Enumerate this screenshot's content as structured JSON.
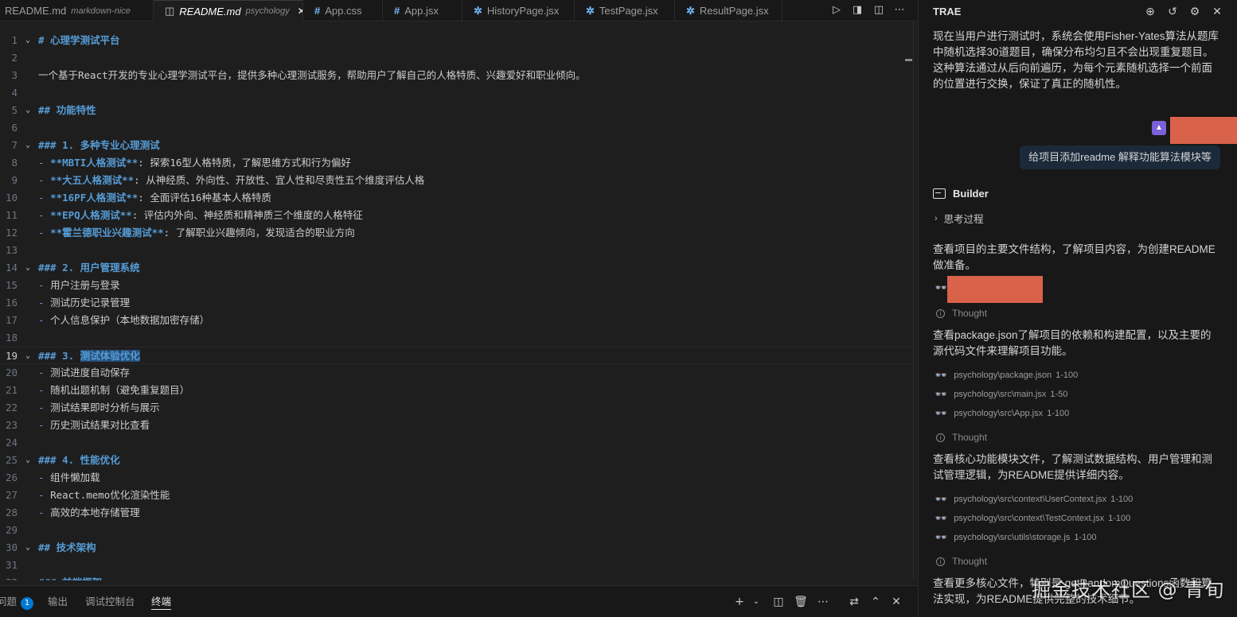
{
  "tabs": [
    {
      "title": "README.md",
      "desc": "markdown-nice",
      "icon": "markdown-icon",
      "active": false,
      "italic": false
    },
    {
      "title": "README.md",
      "desc": "psychology",
      "icon": "markdown-icon",
      "active": true,
      "italic": true,
      "close": "✕"
    },
    {
      "title": "App.css",
      "icon": "hash-icon"
    },
    {
      "title": "App.jsx",
      "icon": "hash-icon"
    },
    {
      "title": "HistoryPage.jsx",
      "icon": "gear-icon"
    },
    {
      "title": "TestPage.jsx",
      "icon": "gear-icon"
    },
    {
      "title": "ResultPage.jsx",
      "icon": "gear-icon"
    }
  ],
  "editor": {
    "current_line": 19,
    "lines": [
      {
        "n": "1",
        "fold": true,
        "parts": [
          {
            "t": "# 心理学测试平台",
            "c": "hd"
          }
        ]
      },
      {
        "n": "2",
        "parts": []
      },
      {
        "n": "3",
        "parts": [
          {
            "t": "一个基于React开发的专业心理学测试平台，提供多种心理测试服务，帮助用户了解自己的人格特质、兴趣爱好和职业倾向。",
            "c": ""
          }
        ]
      },
      {
        "n": "4",
        "parts": []
      },
      {
        "n": "5",
        "fold": true,
        "parts": [
          {
            "t": "## 功能特性",
            "c": "hd"
          }
        ]
      },
      {
        "n": "6",
        "parts": []
      },
      {
        "n": "7",
        "fold": true,
        "parts": [
          {
            "t": "### 1. 多种专业心理测试",
            "c": "hd"
          }
        ]
      },
      {
        "n": "8",
        "parts": [
          {
            "t": "- ",
            "c": "bullet"
          },
          {
            "t": "**MBTI人格测试**",
            "c": "bold"
          },
          {
            "t": ": 探索16型人格特质，了解思维方式和行为偏好",
            "c": ""
          }
        ]
      },
      {
        "n": "9",
        "parts": [
          {
            "t": "- ",
            "c": "bullet"
          },
          {
            "t": "**大五人格测试**",
            "c": "bold"
          },
          {
            "t": ": 从神经质、外向性、开放性、宜人性和尽责性五个维度评估人格",
            "c": ""
          }
        ]
      },
      {
        "n": "10",
        "parts": [
          {
            "t": "- ",
            "c": "bullet"
          },
          {
            "t": "**16PF人格测试**",
            "c": "bold"
          },
          {
            "t": ": 全面评估16种基本人格特质",
            "c": ""
          }
        ]
      },
      {
        "n": "11",
        "parts": [
          {
            "t": "- ",
            "c": "bullet"
          },
          {
            "t": "**EPQ人格测试**",
            "c": "bold"
          },
          {
            "t": ": 评估内外向、神经质和精神质三个维度的人格特征",
            "c": ""
          }
        ]
      },
      {
        "n": "12",
        "parts": [
          {
            "t": "- ",
            "c": "bullet"
          },
          {
            "t": "**霍兰德职业兴趣测试**",
            "c": "bold"
          },
          {
            "t": ": 了解职业兴趣倾向，发现适合的职业方向",
            "c": ""
          }
        ]
      },
      {
        "n": "13",
        "parts": []
      },
      {
        "n": "14",
        "fold": true,
        "parts": [
          {
            "t": "### 2. 用户管理系统",
            "c": "hd"
          }
        ]
      },
      {
        "n": "15",
        "parts": [
          {
            "t": "- ",
            "c": "bullet"
          },
          {
            "t": "用户注册与登录",
            "c": ""
          }
        ]
      },
      {
        "n": "16",
        "parts": [
          {
            "t": "- ",
            "c": "bullet"
          },
          {
            "t": "测试历史记录管理",
            "c": ""
          }
        ]
      },
      {
        "n": "17",
        "parts": [
          {
            "t": "- ",
            "c": "bullet"
          },
          {
            "t": "个人信息保护（本地数据加密存储）",
            "c": ""
          }
        ]
      },
      {
        "n": "18",
        "parts": []
      },
      {
        "n": "19",
        "fold": true,
        "parts": [
          {
            "t": "### 3. ",
            "c": "hd"
          },
          {
            "t": "测试体验优化",
            "c": "hd sel"
          }
        ]
      },
      {
        "n": "20",
        "parts": [
          {
            "t": "- ",
            "c": "bullet"
          },
          {
            "t": "测试进度自动保存",
            "c": ""
          }
        ]
      },
      {
        "n": "21",
        "parts": [
          {
            "t": "- ",
            "c": "bullet"
          },
          {
            "t": "随机出题机制（避免重复题目）",
            "c": ""
          }
        ]
      },
      {
        "n": "22",
        "parts": [
          {
            "t": "- ",
            "c": "bullet"
          },
          {
            "t": "测试结果即时分析与展示",
            "c": ""
          }
        ]
      },
      {
        "n": "23",
        "parts": [
          {
            "t": "- ",
            "c": "bullet"
          },
          {
            "t": "历史测试结果对比查看",
            "c": ""
          }
        ]
      },
      {
        "n": "24",
        "parts": []
      },
      {
        "n": "25",
        "fold": true,
        "parts": [
          {
            "t": "### 4. 性能优化",
            "c": "hd"
          }
        ]
      },
      {
        "n": "26",
        "parts": [
          {
            "t": "- ",
            "c": "bullet"
          },
          {
            "t": "组件懒加载",
            "c": ""
          }
        ]
      },
      {
        "n": "27",
        "parts": [
          {
            "t": "- ",
            "c": "bullet"
          },
          {
            "t": "React.memo优化渲染性能",
            "c": ""
          }
        ]
      },
      {
        "n": "28",
        "parts": [
          {
            "t": "- ",
            "c": "bullet"
          },
          {
            "t": "高效的本地存储管理",
            "c": ""
          }
        ]
      },
      {
        "n": "29",
        "parts": []
      },
      {
        "n": "30",
        "fold": true,
        "parts": [
          {
            "t": "## 技术架构",
            "c": "hd"
          }
        ]
      },
      {
        "n": "31",
        "parts": []
      },
      {
        "n": "32",
        "fold": true,
        "parts": [
          {
            "t": "### 前端框架",
            "c": "hd"
          }
        ]
      }
    ]
  },
  "panel": {
    "tabs": [
      {
        "label": "问题",
        "badge": "1"
      },
      {
        "label": "输出"
      },
      {
        "label": "调试控制台"
      },
      {
        "label": "终端",
        "active": true
      }
    ]
  },
  "chat": {
    "title": "TRAE",
    "intro": "现在当用户进行测试时，系统会使用Fisher-Yates算法从题库中随机选择30道题目，确保分布均匀且不会出现重复题目。这种算法通过从后向前遍历，为每个元素随机选择一个前面的位置进行交换，保证了真正的随机性。",
    "user_message": "给项目添加readme 解释功能算法模块等",
    "agent_name": "Builder",
    "thinking_label": "思考过程",
    "step1": "查看项目的主要文件结构，了解项目内容，为创建README做准备。",
    "thought_label": "Thought",
    "step2": "查看package.json了解项目的依赖和构建配置，以及主要的源代码文件来理解项目功能。",
    "files2": [
      {
        "path": "psychology\\package.json",
        "range": "1-100"
      },
      {
        "path": "psychology\\src\\main.jsx",
        "range": "1-50"
      },
      {
        "path": "psychology\\src\\App.jsx",
        "range": "1-100"
      }
    ],
    "step3": "查看核心功能模块文件，了解测试数据结构、用户管理和测试管理逻辑，为README提供详细内容。",
    "files3": [
      {
        "path": "psychology\\src\\context\\UserContext.jsx",
        "range": "1-100"
      },
      {
        "path": "psychology\\src\\context\\TestContext.jsx",
        "range": "1-100"
      },
      {
        "path": "psychology\\src\\utils\\storage.js",
        "range": "1-100"
      }
    ],
    "step4": "查看更多核心文件，特别是 getRandomQuestions函数和算法实现，为README提供完整的技术细节。",
    "watermark": "掘金技术社区 @ 青旬"
  },
  "colors": {
    "accent": "#0078d4",
    "heading": "#569cd6",
    "redaction": "#d9624b",
    "avatar": "#7d5fd8"
  }
}
